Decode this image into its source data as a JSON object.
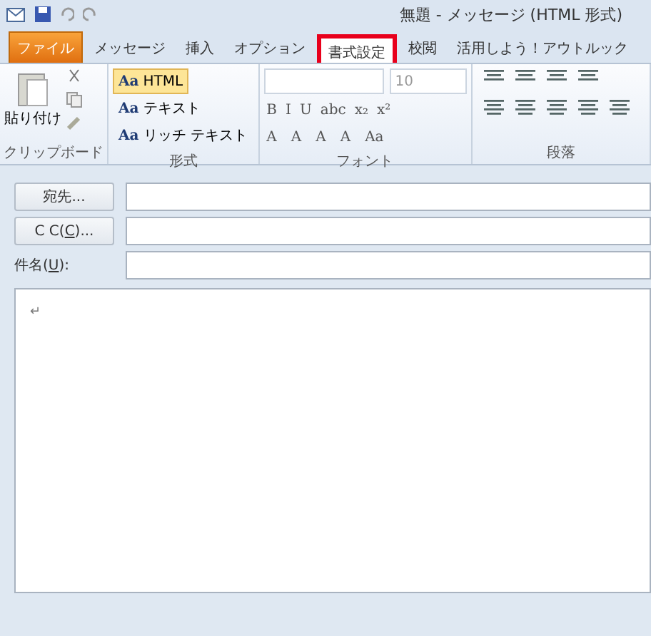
{
  "window": {
    "title": "無題 - メッセージ (HTML 形式)"
  },
  "tabs": [
    {
      "label": "ファイル",
      "kind": "file",
      "selected": false
    },
    {
      "label": "メッセージ",
      "kind": "tab",
      "selected": false
    },
    {
      "label": "挿入",
      "kind": "tab",
      "selected": false
    },
    {
      "label": "オプション",
      "kind": "tab",
      "selected": false
    },
    {
      "label": "書式設定",
      "kind": "tab",
      "selected": true
    },
    {
      "label": "校閲",
      "kind": "tab",
      "selected": false
    },
    {
      "label": "活用しよう！アウトルック",
      "kind": "tab",
      "selected": false
    }
  ],
  "ribbon": {
    "clipboard": {
      "paste": "貼り付け",
      "label": "クリップボード"
    },
    "format": {
      "label": "形式",
      "options": [
        {
          "icon": "Aa",
          "label": "HTML",
          "selected": true
        },
        {
          "icon": "Aa",
          "label": "テキスト",
          "selected": false
        },
        {
          "icon": "Aa",
          "label": "リッチ テキスト",
          "selected": false
        }
      ]
    },
    "font": {
      "label": "フォント",
      "size": "10",
      "styles": [
        "B",
        "I",
        "U",
        "abc",
        "x₂",
        "x²"
      ],
      "letters": [
        "A",
        "A",
        "A",
        "A",
        "Aa"
      ]
    },
    "paragraph": {
      "label": "段落"
    }
  },
  "header_fields": [
    {
      "kind": "button",
      "label": "宛先..."
    },
    {
      "kind": "button",
      "label": "C C(",
      "accel": "C",
      "rest": ")..."
    },
    {
      "kind": "label",
      "label": "件名(",
      "accel": "U",
      "rest": "):"
    }
  ],
  "body": {
    "mark": "↵"
  }
}
